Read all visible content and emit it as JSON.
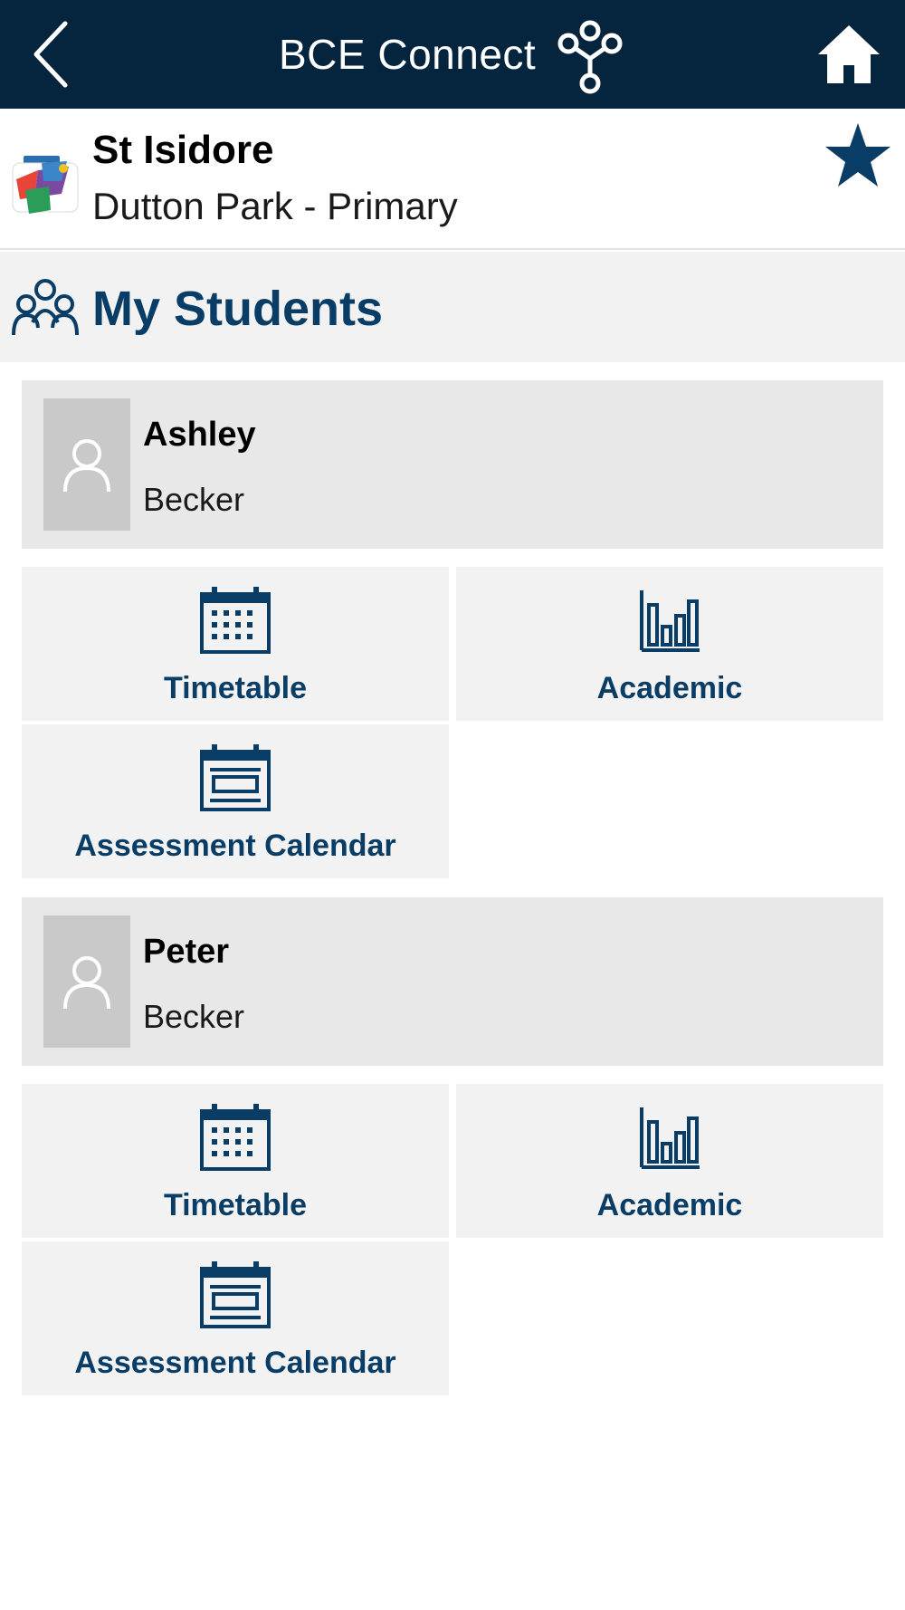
{
  "header": {
    "title": "BCE Connect",
    "back_icon": "chevron-left-icon",
    "connect_icon": "connect-nodes-icon",
    "home_icon": "home-icon",
    "background_color": "#05243d"
  },
  "school": {
    "name": "St Isidore",
    "subtitle": "Dutton Park - Primary",
    "logo_icon": "school-logo",
    "favorite_icon": "star-icon",
    "favorited": true
  },
  "section": {
    "title": "My Students",
    "icon": "group-icon"
  },
  "accent_color": "#0a3d66",
  "students": [
    {
      "first_name": "Ashley",
      "last_name": "Becker",
      "tiles": [
        {
          "label": "Timetable",
          "icon": "calendar-grid-icon"
        },
        {
          "label": "Academic",
          "icon": "bar-chart-icon"
        },
        {
          "label": "Assessment Calendar",
          "icon": "calendar-list-icon"
        }
      ]
    },
    {
      "first_name": "Peter",
      "last_name": "Becker",
      "tiles": [
        {
          "label": "Timetable",
          "icon": "calendar-grid-icon"
        },
        {
          "label": "Academic",
          "icon": "bar-chart-icon"
        },
        {
          "label": "Assessment Calendar",
          "icon": "calendar-list-icon"
        }
      ]
    }
  ]
}
